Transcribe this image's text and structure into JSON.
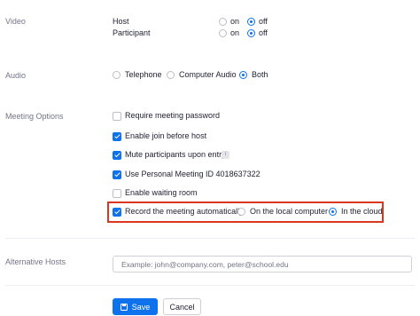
{
  "video": {
    "section_label": "Video",
    "host_label": "Host",
    "participant_label": "Participant",
    "on_label": "on",
    "off_label": "off",
    "host_value": "off",
    "participant_value": "off"
  },
  "audio": {
    "section_label": "Audio",
    "options": [
      "Telephone",
      "Computer Audio",
      "Both"
    ],
    "selected": "Both"
  },
  "meeting_options": {
    "section_label": "Meeting Options",
    "items": [
      {
        "label": "Require meeting password",
        "checked": false
      },
      {
        "label": "Enable join before host",
        "checked": true
      },
      {
        "label": "Mute participants upon entry",
        "checked": true
      },
      {
        "label": "Use Personal Meeting ID 4018637322",
        "checked": true
      },
      {
        "label": "Enable waiting room",
        "checked": false
      },
      {
        "label": "Record the meeting automatically",
        "checked": true
      }
    ],
    "record_options": [
      "On the local computer",
      "In the cloud"
    ],
    "record_selected": "In the cloud"
  },
  "alternative_hosts": {
    "section_label": "Alternative Hosts",
    "placeholder": "Example: john@company.com, peter@school.edu",
    "value": ""
  },
  "actions": {
    "save_label": "Save",
    "cancel_label": "Cancel"
  },
  "colors": {
    "accent": "#0e72ed",
    "highlight_border": "#d9381e",
    "label_gray": "#747487"
  }
}
